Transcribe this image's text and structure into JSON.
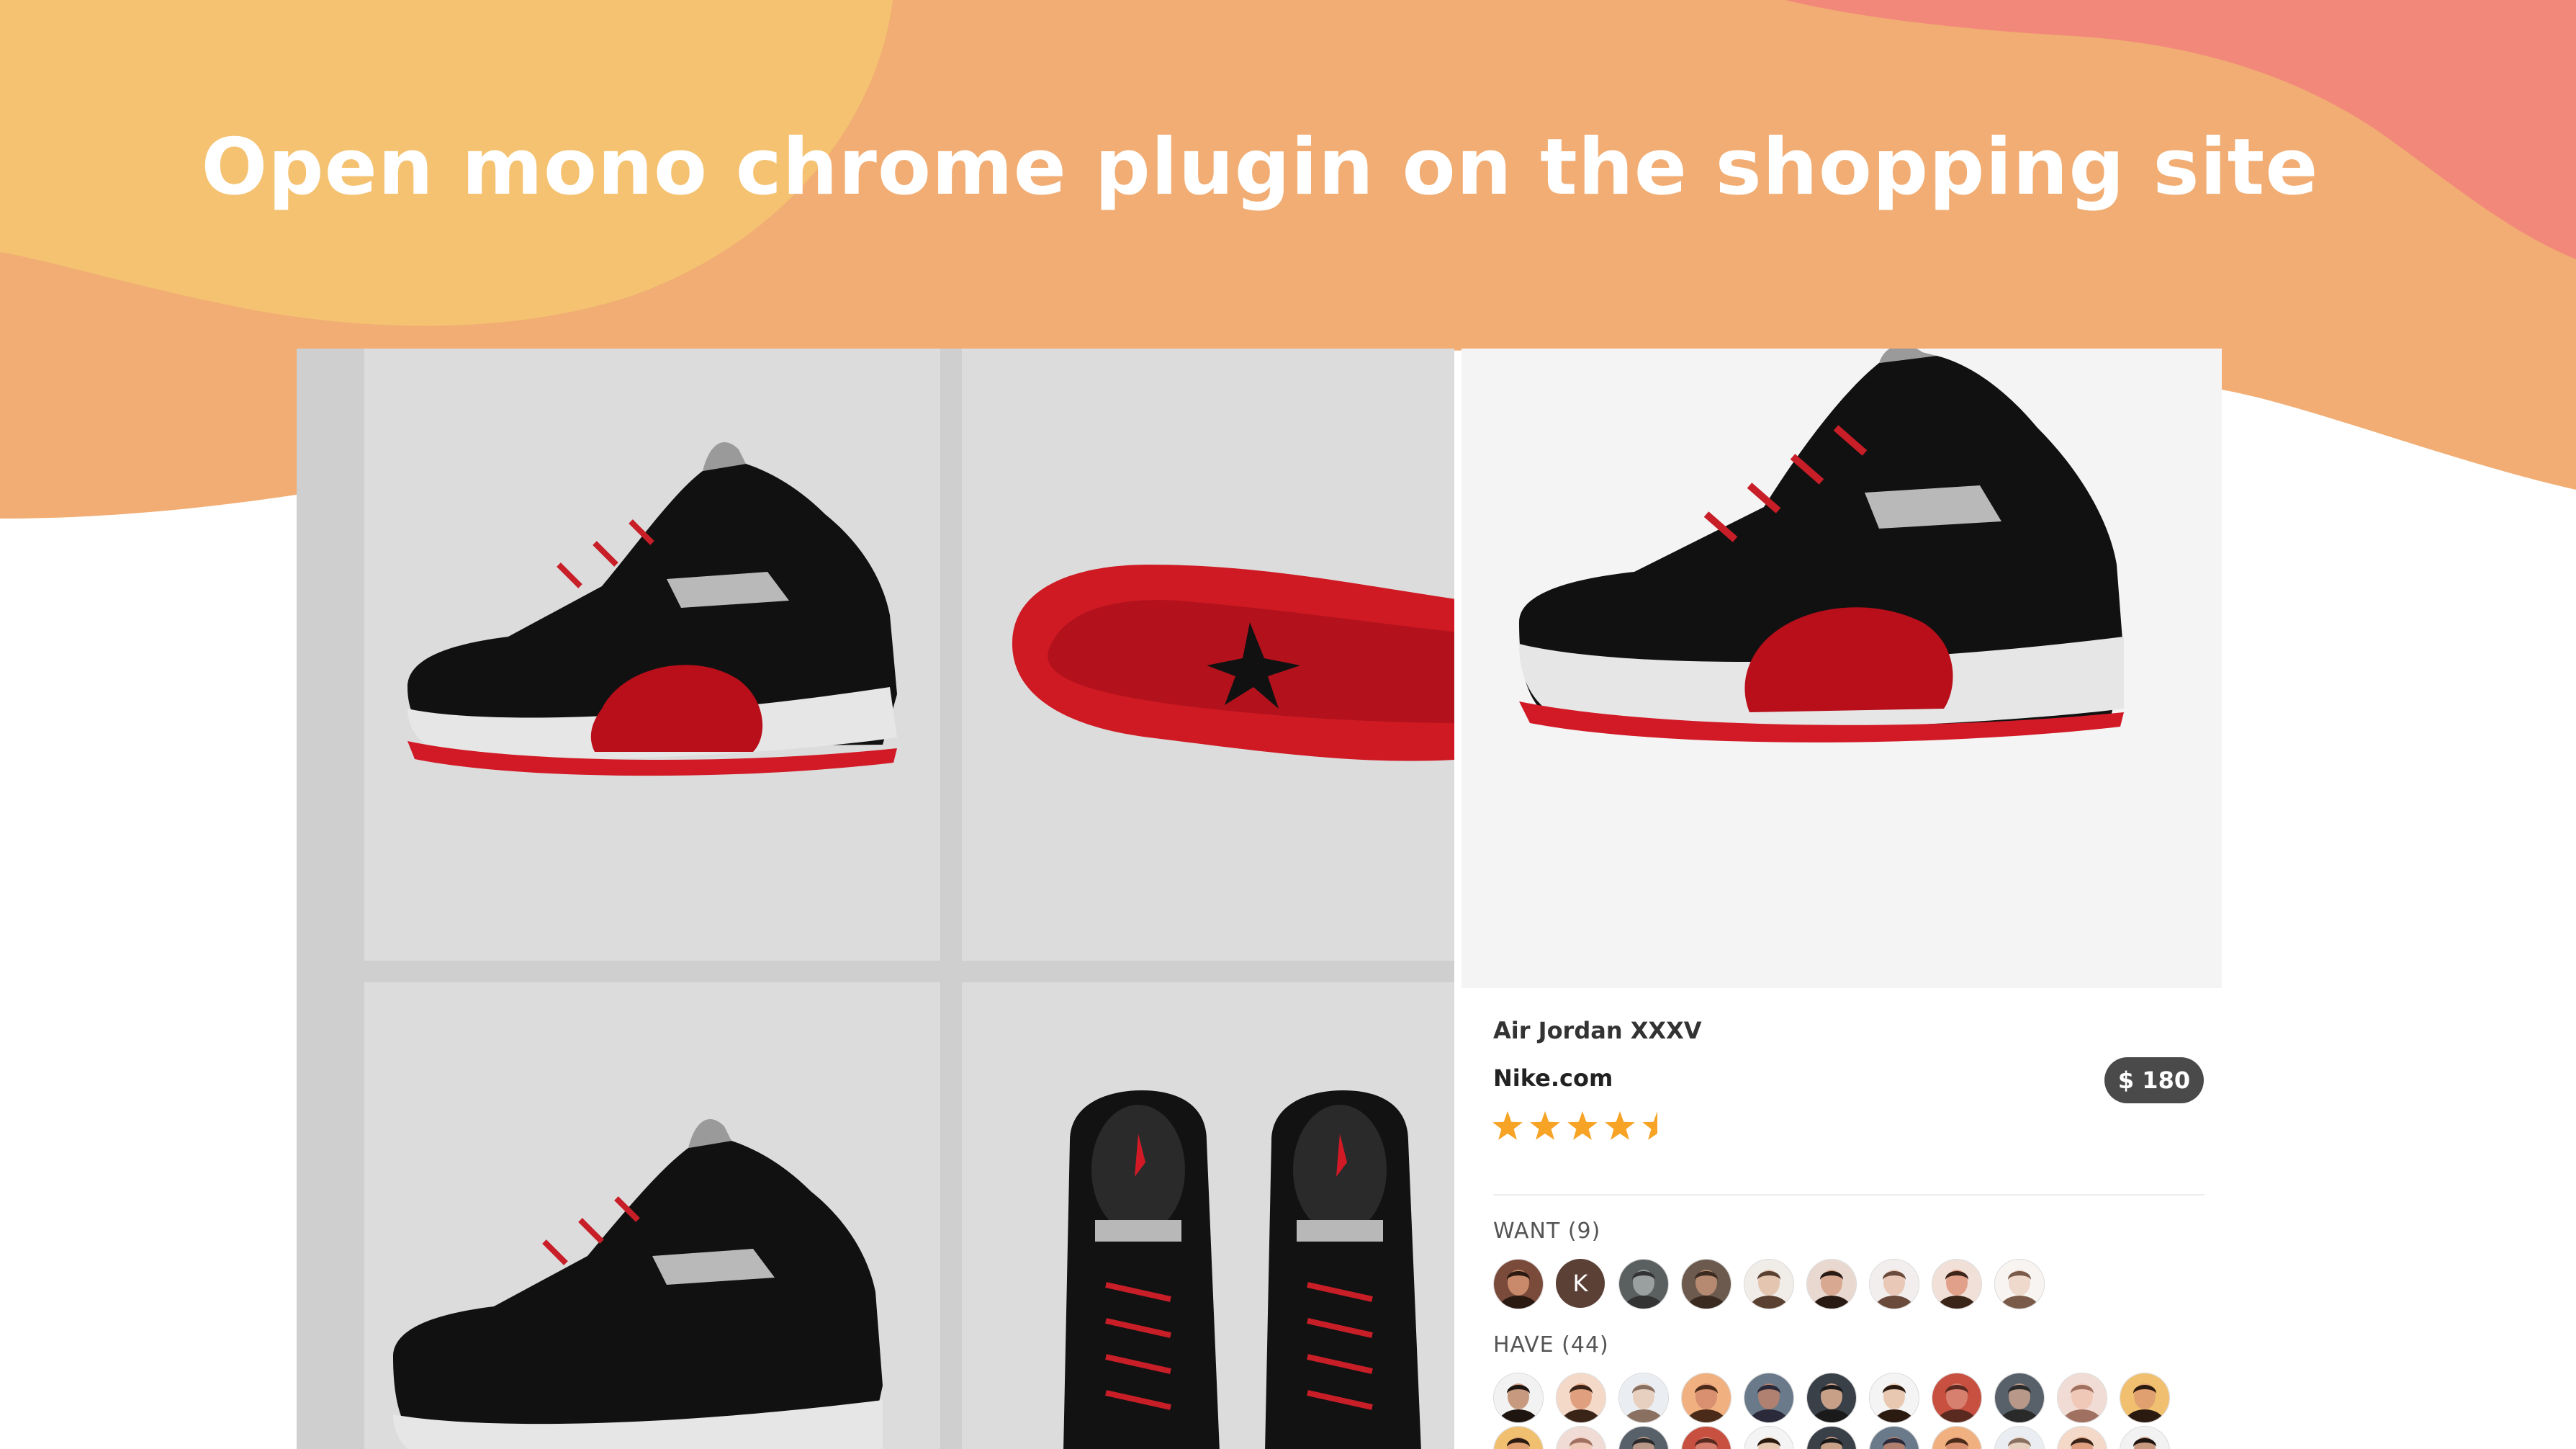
{
  "headline": "Open mono chrome plugin on the shopping site",
  "product": {
    "name": "Air Jordan XXXV",
    "store": "Nike.com",
    "price": "$ 180",
    "rating": 5
  },
  "want": {
    "label": "WANT (9)",
    "avatars": [
      {
        "kind": "photo",
        "skin": "#c88a6a",
        "hair": "#2a1a12",
        "bg": "#7a4a3a"
      },
      {
        "kind": "letter",
        "letter": "K"
      },
      {
        "kind": "photo",
        "skin": "#9aa0a0",
        "hair": "#333",
        "bg": "#5a5f5f"
      },
      {
        "kind": "photo",
        "skin": "#b58a70",
        "hair": "#3a2a20",
        "bg": "#6c5a4e"
      },
      {
        "kind": "photo",
        "skin": "#e3c5b0",
        "hair": "#5a4030",
        "bg": "#f0ece8"
      },
      {
        "kind": "photo",
        "skin": "#d8a890",
        "hair": "#2a1a14",
        "bg": "#e8d8d0"
      },
      {
        "kind": "photo",
        "skin": "#e9c8b8",
        "hair": "#6a4a3a",
        "bg": "#f3eeee"
      },
      {
        "kind": "photo",
        "skin": "#e0a08a",
        "hair": "#3b2418",
        "bg": "#f0e0d8"
      },
      {
        "kind": "photo",
        "skin": "#efd8cc",
        "hair": "#7a5a48",
        "bg": "#f7f4f2"
      }
    ]
  },
  "have": {
    "label": "HAVE (44)",
    "avatars": [
      {
        "kind": "photo",
        "skin": "#c79a80",
        "hair": "#1e1410",
        "bg": "#f2f2f2"
      },
      {
        "kind": "photo",
        "skin": "#e0a080",
        "hair": "#3a2418",
        "bg": "#f4d8c8"
      },
      {
        "kind": "photo",
        "skin": "#e8d0c0",
        "hair": "#8a7060",
        "bg": "#eaeef2"
      },
      {
        "kind": "photo",
        "skin": "#d89070",
        "hair": "#4a2a18",
        "bg": "#f0b080"
      },
      {
        "kind": "photo",
        "skin": "#b08070",
        "hair": "#2a2a3a",
        "bg": "#6a7a8a"
      },
      {
        "kind": "photo",
        "skin": "#c8a088",
        "hair": "#1a1a1a",
        "bg": "#3a4048"
      },
      {
        "kind": "photo",
        "skin": "#e8c8b0",
        "hair": "#2a1a10",
        "bg": "#f4f4f4"
      },
      {
        "kind": "photo",
        "skin": "#d88070",
        "hair": "#5a2a20",
        "bg": "#c85040"
      },
      {
        "kind": "photo",
        "skin": "#b89888",
        "hair": "#2a2a2a",
        "bg": "#58606a"
      },
      {
        "kind": "photo",
        "skin": "#f0c8b8",
        "hair": "#a07060",
        "bg": "#f0dcd4"
      },
      {
        "kind": "photo",
        "skin": "#e0a070",
        "hair": "#2a1a10",
        "bg": "#f0c070"
      }
    ]
  },
  "colors": {
    "blob_yellow": "#f4c271",
    "blob_orange": "#f1ad73",
    "blob_coral": "#f2887a",
    "price_pill": "#4a4a4a",
    "star": "#f7a325"
  }
}
